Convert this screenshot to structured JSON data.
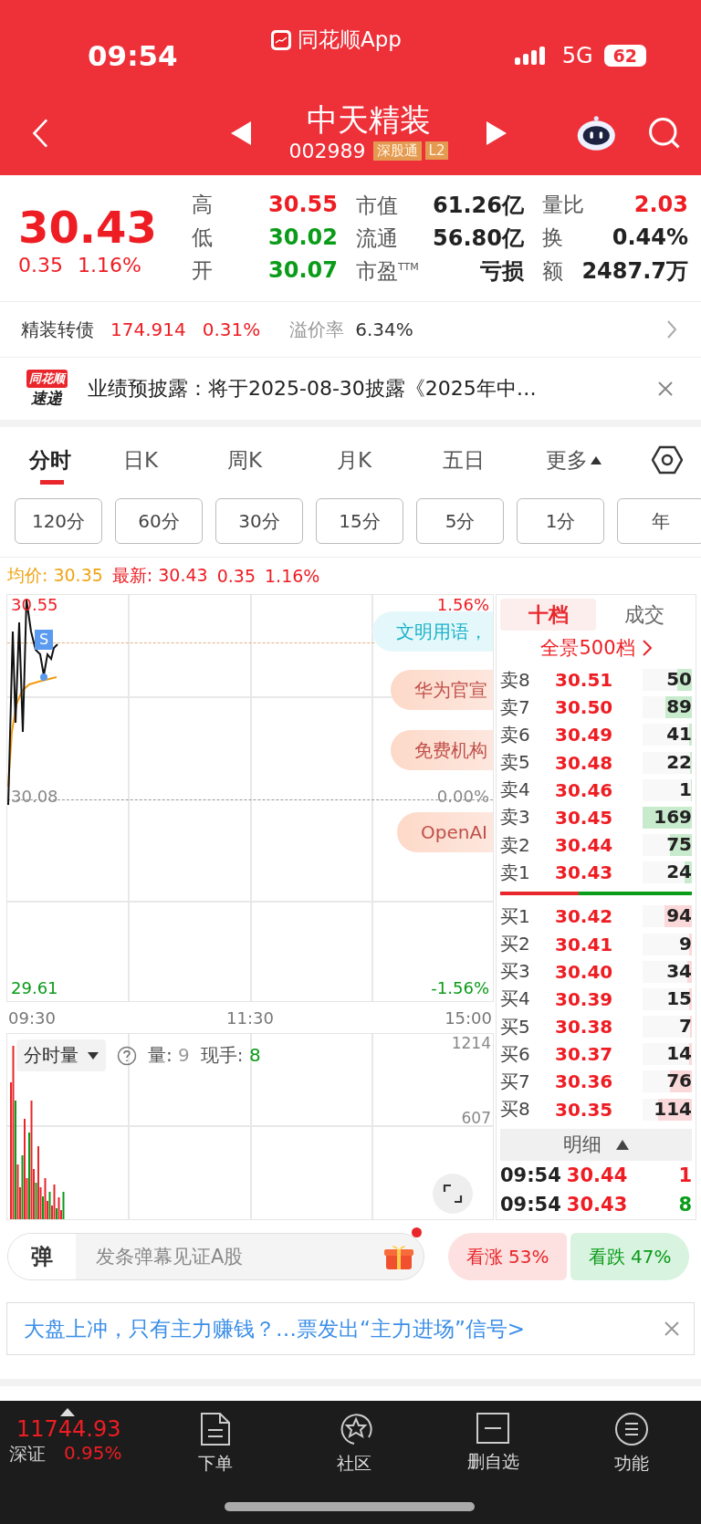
{
  "status_bar": {
    "time": "09:54",
    "app": "同花顺App",
    "network": "5G",
    "battery": "62"
  },
  "header": {
    "name": "中天精装",
    "code": "002989",
    "tags": [
      "深股通",
      "L2"
    ]
  },
  "quote": {
    "price": "30.43",
    "change": "0.35",
    "change_pct": "1.16%",
    "stats": [
      {
        "label": "高",
        "value": "30.55",
        "kind": "up"
      },
      {
        "label": "市值",
        "value": "61.26亿",
        "kind": "flat"
      },
      {
        "label": "量比",
        "value": "2.03",
        "kind": "up"
      },
      {
        "label": "低",
        "value": "30.02",
        "kind": "down"
      },
      {
        "label": "流通",
        "value": "56.80亿",
        "kind": "flat"
      },
      {
        "label": "换",
        "value": "0.44%",
        "kind": "flat"
      },
      {
        "label": "开",
        "value": "30.07",
        "kind": "down"
      },
      {
        "label": "市盈$^{TTM}$",
        "value": "亏损",
        "kind": "flat"
      },
      {
        "label": "额",
        "value": "2487.7万",
        "kind": "flat"
      }
    ]
  },
  "bond": {
    "name": "精装转债",
    "price": "174.914",
    "change_pct": "0.31%",
    "premium_label": "溢价率",
    "premium": "6.34%"
  },
  "news": {
    "badge_top": "同花顺",
    "badge_bottom": "速递",
    "text": "业绩预披露：将于2025-08-30披露《2025年中…"
  },
  "tabs": [
    {
      "label": "分时",
      "selected": true,
      "kind": "plain"
    },
    {
      "label": "日K",
      "selected": false,
      "kind": "plain"
    },
    {
      "label": "周K",
      "selected": false,
      "kind": "plain"
    },
    {
      "label": "月K",
      "selected": false,
      "kind": "plain"
    },
    {
      "label": "五日",
      "selected": false,
      "kind": "plain"
    },
    {
      "label": "更多",
      "selected": false,
      "kind": "dropdown"
    }
  ],
  "periods": [
    "120分",
    "60分",
    "30分",
    "15分",
    "5分",
    "1分",
    "年"
  ],
  "info": {
    "avg_label": "均价:",
    "avg": "30.35",
    "latest_label": "最新:",
    "latest": "30.43",
    "change": "0.35",
    "change_pct": "1.16%"
  },
  "chart": {
    "y_high": "30.55",
    "y_mid": "30.08",
    "y_low": "29.61",
    "pct_high": "1.56%",
    "pct_mid": "0.00%",
    "pct_low": "-1.56%",
    "marker": "S",
    "times": [
      "09:30",
      "11:30",
      "15:00"
    ],
    "bubbles": [
      {
        "text": "文明用语，",
        "kind": "tip"
      },
      {
        "text": "华为官宣",
        "kind": "topic"
      },
      {
        "text": "免费机构",
        "kind": "topic"
      },
      {
        "text": "OpenAI",
        "kind": "topic"
      }
    ]
  },
  "volume": {
    "label": "分时量",
    "vol_label": "量:",
    "vol": "9",
    "hand_label": "现手:",
    "hand": "8",
    "tick_high": "1214",
    "tick_mid": "607"
  },
  "orderbook": {
    "tabs": [
      {
        "label": "十档",
        "selected": true
      },
      {
        "label": "成交",
        "selected": false
      }
    ],
    "panorama": "全景500档",
    "sells": [
      {
        "label": "卖8",
        "price": "30.51",
        "volume": "50",
        "level": 0.3
      },
      {
        "label": "卖7",
        "price": "30.50",
        "volume": "89",
        "level": 0.53
      },
      {
        "label": "卖6",
        "price": "30.49",
        "volume": "41",
        "level": 0.06
      },
      {
        "label": "卖5",
        "price": "30.48",
        "volume": "22",
        "level": 0.04
      },
      {
        "label": "卖4",
        "price": "30.46",
        "volume": "1",
        "level": 0.01
      },
      {
        "label": "卖3",
        "price": "30.45",
        "volume": "169",
        "level": 1
      },
      {
        "label": "卖2",
        "price": "30.44",
        "volume": "75",
        "level": 0.44
      },
      {
        "label": "卖1",
        "price": "30.43",
        "volume": "24",
        "level": 0.14
      }
    ],
    "split": {
      "level": 0.41
    },
    "buys": [
      {
        "label": "买1",
        "price": "30.42",
        "volume": "94",
        "level": 0.56
      },
      {
        "label": "买2",
        "price": "30.41",
        "volume": "9",
        "level": 0.05
      },
      {
        "label": "买3",
        "price": "30.40",
        "volume": "34",
        "level": 0.1
      },
      {
        "label": "买4",
        "price": "30.39",
        "volume": "15",
        "level": 0.06
      },
      {
        "label": "买5",
        "price": "30.38",
        "volume": "7",
        "level": 0.04
      },
      {
        "label": "买6",
        "price": "30.37",
        "volume": "14",
        "level": 0.06
      },
      {
        "label": "买7",
        "price": "30.36",
        "volume": "76",
        "level": 0.45
      },
      {
        "label": "买8",
        "price": "30.35",
        "volume": "114",
        "level": 0.68
      }
    ],
    "detail_label": "明细",
    "trades": [
      {
        "time": "09:54",
        "price": "30.44",
        "volume": "1",
        "kind": "up"
      },
      {
        "time": "09:54",
        "price": "30.43",
        "volume": "8",
        "kind": "down"
      }
    ]
  },
  "danmaku": {
    "badge": "弹",
    "placeholder": "发条弹幕见证A股"
  },
  "sentiment": [
    {
      "label": "看涨",
      "value": "53%",
      "kind": "up"
    },
    {
      "label": "看跌",
      "value": "47%",
      "kind": "down"
    }
  ],
  "banner": {
    "text": "大盘上冲，只有主力赚钱？…票发出“主力进场”信号>"
  },
  "bottom": {
    "index": {
      "value": "11744.93",
      "name": "深证",
      "change_pct": "0.95%"
    },
    "nav": [
      {
        "label": "下单",
        "kind": "order"
      },
      {
        "label": "社区",
        "kind": "community"
      },
      {
        "label": "删自选",
        "kind": "remove"
      },
      {
        "label": "功能",
        "kind": "functions"
      }
    ]
  }
}
